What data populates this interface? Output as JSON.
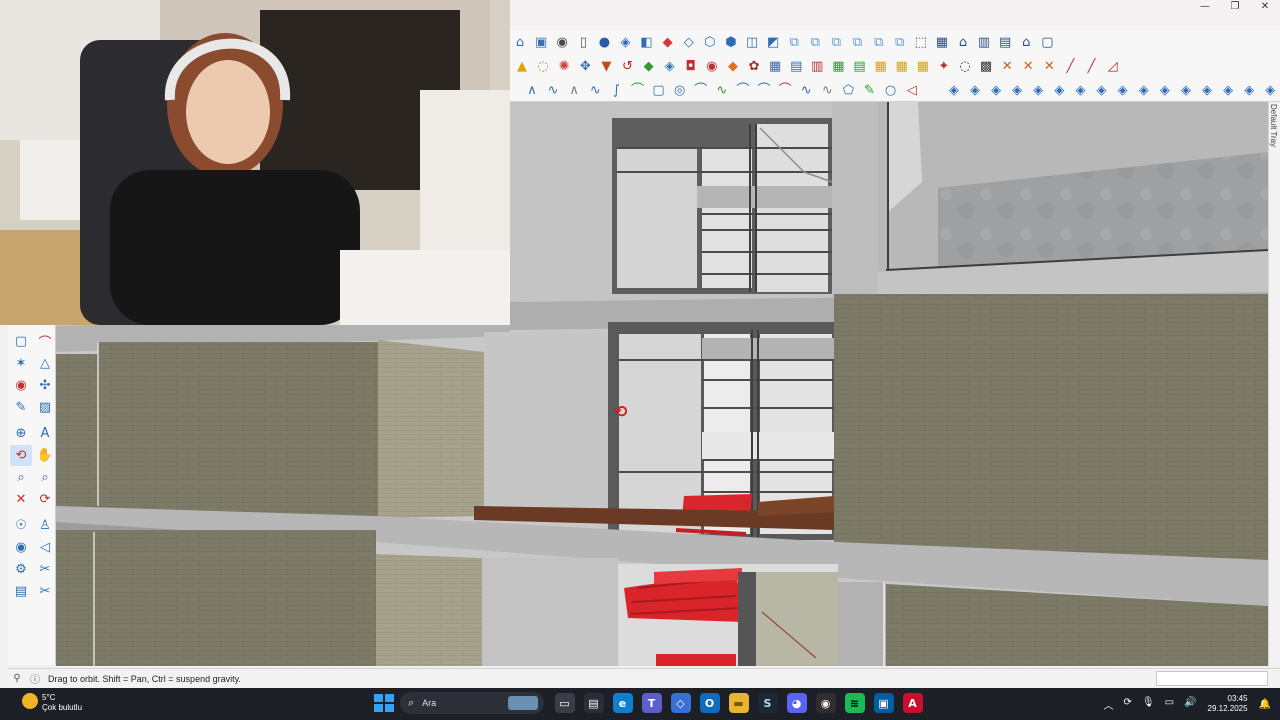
{
  "window": {
    "controls": [
      "—",
      "❐",
      "✕"
    ],
    "tray_label": "Default Tray"
  },
  "toolbars": {
    "row1": [
      {
        "icon": "warehouse-icon",
        "glyph": "⌂",
        "color": "#3b6fb6"
      },
      {
        "icon": "components-icon",
        "glyph": "▣",
        "color": "#3b6fb6"
      },
      {
        "icon": "user-settings-icon",
        "glyph": "◉",
        "color": "#4a4a4a"
      },
      {
        "icon": "new-file-icon",
        "glyph": "▯",
        "color": "#555"
      },
      {
        "icon": "account-icon",
        "glyph": "●",
        "color": "#2a5ca8"
      },
      {
        "icon": "sandbox-icon",
        "glyph": "◈",
        "color": "#2e6db4"
      },
      {
        "icon": "section-icon",
        "glyph": "◧",
        "color": "#2e6db4"
      },
      {
        "icon": "paint-icon",
        "glyph": "◆",
        "color": "#d23b3b"
      },
      {
        "icon": "style-icon",
        "glyph": "◇",
        "color": "#2e6db4"
      },
      {
        "icon": "iso-view-icon",
        "glyph": "⬡",
        "color": "#2e6db4"
      },
      {
        "icon": "top-view-icon",
        "glyph": "⬢",
        "color": "#2e6db4"
      },
      {
        "icon": "front-view-icon",
        "glyph": "◫",
        "color": "#2e6db4"
      },
      {
        "icon": "right-view-icon",
        "glyph": "◩",
        "color": "#2e6db4"
      },
      {
        "icon": "copy-icon",
        "glyph": "⧉",
        "color": "#5a9ad6"
      },
      {
        "icon": "move-icon",
        "glyph": "⧉",
        "color": "#5a9ad6"
      },
      {
        "icon": "rotate-icon",
        "glyph": "⧉",
        "color": "#5a9ad6"
      },
      {
        "icon": "scale-icon",
        "glyph": "⧉",
        "color": "#5a9ad6"
      },
      {
        "icon": "offset-icon",
        "glyph": "⧉",
        "color": "#5a9ad6"
      },
      {
        "icon": "array-icon",
        "glyph": "⧉",
        "color": "#5a9ad6"
      },
      {
        "icon": "box-icon",
        "glyph": "⬚",
        "color": "#2e4d80"
      },
      {
        "icon": "wall-icon",
        "glyph": "▦",
        "color": "#2e4d80"
      },
      {
        "icon": "house-icon",
        "glyph": "⌂",
        "color": "#2e4d80"
      },
      {
        "icon": "grid-icon",
        "glyph": "▥",
        "color": "#2e4d80"
      },
      {
        "icon": "panel-icon",
        "glyph": "▤",
        "color": "#2e4d80"
      },
      {
        "icon": "roof-icon",
        "glyph": "⌂",
        "color": "#2e4d80"
      },
      {
        "icon": "frame-icon",
        "glyph": "▢",
        "color": "#2e4d80"
      }
    ],
    "row2": [
      {
        "icon": "warning-icon",
        "glyph": "▲",
        "color": "#e0a400"
      },
      {
        "icon": "lasso-icon",
        "glyph": "◌",
        "color": "#e08000"
      },
      {
        "icon": "cycle-icon",
        "glyph": "✺",
        "color": "#d04040"
      },
      {
        "icon": "move-arrows-icon",
        "glyph": "✥",
        "color": "#2e6db4"
      },
      {
        "icon": "bucket-icon",
        "glyph": "▼",
        "color": "#c84a1a"
      },
      {
        "icon": "undo-icon",
        "glyph": "↺",
        "color": "#d02020"
      },
      {
        "icon": "gem-icon",
        "glyph": "◆",
        "color": "#2a9d2a"
      },
      {
        "icon": "cube-icon",
        "glyph": "◈",
        "color": "#3b6fb6"
      },
      {
        "icon": "solid-icon",
        "glyph": "◘",
        "color": "#c03030"
      },
      {
        "icon": "fill-icon",
        "glyph": "◉",
        "color": "#c03030"
      },
      {
        "icon": "diamond-icon",
        "glyph": "◆",
        "color": "#e07020"
      },
      {
        "icon": "cluster-icon",
        "glyph": "✿",
        "color": "#a03030"
      },
      {
        "icon": "table-icon",
        "glyph": "▦",
        "color": "#2e6db4"
      },
      {
        "icon": "layers-icon",
        "glyph": "▤",
        "color": "#2e6db4"
      },
      {
        "icon": "stack-icon",
        "glyph": "▥",
        "color": "#c03030"
      },
      {
        "icon": "grid-green-icon",
        "glyph": "▦",
        "color": "#2a9d2a"
      },
      {
        "icon": "stack-green-icon",
        "glyph": "▤",
        "color": "#2a9d2a"
      },
      {
        "icon": "cell-yellow-icon",
        "glyph": "▦",
        "color": "#e0a000"
      },
      {
        "icon": "cell-yellow-2-icon",
        "glyph": "▦",
        "color": "#e0a000"
      },
      {
        "icon": "cell-yellow-3-icon",
        "glyph": "▦",
        "color": "#e0a000"
      },
      {
        "icon": "scatter-icon",
        "glyph": "✦",
        "color": "#c03030"
      },
      {
        "icon": "rotate-dash-icon",
        "glyph": "◌",
        "color": "#333"
      },
      {
        "icon": "grid-dots-icon",
        "glyph": "▩",
        "color": "#333"
      },
      {
        "icon": "cross-1-icon",
        "glyph": "✕",
        "color": "#d06020"
      },
      {
        "icon": "cross-2-icon",
        "glyph": "✕",
        "color": "#d06020"
      },
      {
        "icon": "cross-3-icon",
        "glyph": "✕",
        "color": "#d06020"
      },
      {
        "icon": "line-extend-icon",
        "glyph": "╱",
        "color": "#c03030"
      },
      {
        "icon": "line-trim-icon",
        "glyph": "╱",
        "color": "#c03030"
      },
      {
        "icon": "bound-icon",
        "glyph": "◿",
        "color": "#c03030"
      }
    ],
    "row3": [
      {
        "icon": "curve-1-icon",
        "glyph": "∧",
        "color": "#2e6db4"
      },
      {
        "icon": "curve-2-icon",
        "glyph": "∿",
        "color": "#2e6db4"
      },
      {
        "icon": "curve-3-icon",
        "glyph": "∧",
        "color": "#7a7a7a"
      },
      {
        "icon": "curve-4-icon",
        "glyph": "∿",
        "color": "#2e6db4"
      },
      {
        "icon": "curve-5-icon",
        "glyph": "∫",
        "color": "#2e6db4"
      },
      {
        "icon": "arc-icon",
        "glyph": "⌒",
        "color": "#2a9d2a"
      },
      {
        "icon": "rect-icon",
        "glyph": "▢",
        "color": "#2e6db4"
      },
      {
        "icon": "spiral-icon",
        "glyph": "◎",
        "color": "#2e6db4"
      },
      {
        "icon": "bend-icon",
        "glyph": "⌒",
        "color": "#2e6db4"
      },
      {
        "icon": "wave-icon",
        "glyph": "∿",
        "color": "#2a9d2a"
      },
      {
        "icon": "arc-2-icon",
        "glyph": "⌒",
        "color": "#2e6db4"
      },
      {
        "icon": "arc-3-icon",
        "glyph": "⌒",
        "color": "#2e6db4"
      },
      {
        "icon": "arc-red-icon",
        "glyph": "⌒",
        "color": "#c03030"
      },
      {
        "icon": "curve-6-icon",
        "glyph": "∿",
        "color": "#2e6db4"
      },
      {
        "icon": "zigzag-icon",
        "glyph": "∿",
        "color": "#7a7a7a"
      },
      {
        "icon": "polygon-icon",
        "glyph": "⬠",
        "color": "#2e6db4"
      },
      {
        "icon": "pencil-icon",
        "glyph": "✎",
        "color": "#2a9d2a"
      },
      {
        "icon": "circle-icon",
        "glyph": "○",
        "color": "#2e6db4"
      },
      {
        "icon": "tag-icon",
        "glyph": "◁",
        "color": "#c03030"
      },
      {
        "icon": "pad-1-icon",
        "glyph": "",
        "color": "#fff"
      },
      {
        "icon": "shape-1-icon",
        "glyph": "◈",
        "color": "#2e6db4"
      },
      {
        "icon": "shape-2-icon",
        "glyph": "◈",
        "color": "#2e6db4"
      },
      {
        "icon": "shape-3-icon",
        "glyph": "◈",
        "color": "#2e6db4"
      },
      {
        "icon": "shape-4-icon",
        "glyph": "◈",
        "color": "#2e6db4"
      },
      {
        "icon": "shape-5-icon",
        "glyph": "◈",
        "color": "#2e6db4"
      },
      {
        "icon": "shape-6-icon",
        "glyph": "◈",
        "color": "#2e6db4"
      },
      {
        "icon": "shape-7-icon",
        "glyph": "◈",
        "color": "#2e6db4"
      },
      {
        "icon": "shape-8-icon",
        "glyph": "◈",
        "color": "#2e6db4"
      },
      {
        "icon": "shape-9-icon",
        "glyph": "◈",
        "color": "#2e6db4"
      },
      {
        "icon": "shape-10-icon",
        "glyph": "◈",
        "color": "#2e6db4"
      },
      {
        "icon": "shape-11-icon",
        "glyph": "◈",
        "color": "#2e6db4"
      },
      {
        "icon": "shape-12-icon",
        "glyph": "◈",
        "color": "#2e6db4"
      },
      {
        "icon": "shape-13-icon",
        "glyph": "◈",
        "color": "#2e6db4"
      },
      {
        "icon": "shape-14-icon",
        "glyph": "◈",
        "color": "#2e6db4"
      },
      {
        "icon": "shape-15-icon",
        "glyph": "◈",
        "color": "#2e6db4"
      },
      {
        "icon": "shape-16-icon",
        "glyph": "◈",
        "color": "#2e6db4"
      },
      {
        "icon": "shape-17-icon",
        "glyph": "◈",
        "color": "#2e6db4"
      },
      {
        "icon": "shape-18-icon",
        "glyph": "◈",
        "color": "#2e6db4"
      }
    ]
  },
  "left_palette": [
    {
      "icon": "rectangle-select-icon",
      "glyph": "▢",
      "color": "#2e6db4"
    },
    {
      "icon": "lasso-red-icon",
      "glyph": "⌒",
      "color": "#c03030"
    },
    {
      "icon": "scatter-tool-icon",
      "glyph": "✶",
      "color": "#2e6db4"
    },
    {
      "icon": "triangle-tool-icon",
      "glyph": "△",
      "color": "#2e6db4"
    },
    {
      "icon": "point-tool-icon",
      "glyph": "◉",
      "color": "#c03030"
    },
    {
      "icon": "nodes-tool-icon",
      "glyph": "✣",
      "color": "#2e6db4"
    },
    {
      "icon": "pen-tool-icon",
      "glyph": "✎",
      "color": "#2e6db4"
    },
    {
      "icon": "image-tool-icon",
      "glyph": "▨",
      "color": "#2e6db4"
    },
    {
      "icon": "target-tool-icon",
      "glyph": "⊕",
      "color": "#2e6db4"
    },
    {
      "icon": "text-tool-icon",
      "glyph": "A",
      "color": "#2e6db4"
    },
    {
      "icon": "orbit-tool-icon",
      "glyph": "⟲",
      "color": "#c03030",
      "active": true
    },
    {
      "icon": "pan-tool-icon",
      "glyph": "✋",
      "color": "#2e6db4"
    },
    {
      "icon": "zoom-tool-icon",
      "glyph": "⌕",
      "color": "#2e6db4"
    },
    {
      "icon": "zoom-window-icon",
      "glyph": "⌕",
      "color": "#2e6db4"
    },
    {
      "icon": "zoom-extents-icon",
      "glyph": "✕",
      "color": "#c03030"
    },
    {
      "icon": "previous-view-icon",
      "glyph": "⟳",
      "color": "#c03030"
    },
    {
      "icon": "position-camera-icon",
      "glyph": "☉",
      "color": "#2e6db4"
    },
    {
      "icon": "walk-icon",
      "glyph": "♙",
      "color": "#2e6db4"
    },
    {
      "icon": "look-around-icon",
      "glyph": "◉",
      "color": "#2e6db4"
    },
    {
      "icon": "section-plane-icon",
      "glyph": "◁",
      "color": "#2e6db4"
    },
    {
      "icon": "settings-wheel-icon",
      "glyph": "⚙",
      "color": "#2e6db4"
    },
    {
      "icon": "tools-icon",
      "glyph": "✂",
      "color": "#2e6db4"
    },
    {
      "icon": "stack-tool-icon",
      "glyph": "▤",
      "color": "#2e6db4"
    },
    {
      "icon": "paths-tool-icon",
      "glyph": "✂",
      "color": "#2e6db4"
    }
  ],
  "status": {
    "message": "Drag to orbit. Shift = Pan, Ctrl = suspend gravity."
  },
  "taskbar": {
    "weather_temp": "5°C",
    "weather_desc": "Çok bulutlu",
    "search_label": "Ara",
    "apps": [
      {
        "icon": "task-view-icon",
        "glyph": "▭",
        "bg": "#3a3d47",
        "fg": "#fff"
      },
      {
        "icon": "store-icon",
        "glyph": "▤",
        "bg": "#2b2e38",
        "fg": "#fff"
      },
      {
        "icon": "edge-icon",
        "glyph": "e",
        "bg": "#0f7fce",
        "fg": "#fff"
      },
      {
        "icon": "teams-icon",
        "glyph": "T",
        "bg": "#5b5fc7",
        "fg": "#fff"
      },
      {
        "icon": "copilot-icon",
        "glyph": "◇",
        "bg": "#3a6fd8",
        "fg": "#fff"
      },
      {
        "icon": "outlook-icon",
        "glyph": "O",
        "bg": "#0f6cbd",
        "fg": "#fff"
      },
      {
        "icon": "explorer-icon",
        "glyph": "▬",
        "bg": "#e8b532",
        "fg": "#7a5a00"
      },
      {
        "icon": "steam-icon",
        "glyph": "S",
        "bg": "#1b2838",
        "fg": "#c7d5e0"
      },
      {
        "icon": "discord-icon",
        "glyph": "◕",
        "bg": "#5865f2",
        "fg": "#fff"
      },
      {
        "icon": "obs-icon",
        "glyph": "◉",
        "bg": "#302e31",
        "fg": "#fff"
      },
      {
        "icon": "spotify-icon",
        "glyph": "≋",
        "bg": "#1db954",
        "fg": "#000"
      },
      {
        "icon": "sketchup-icon",
        "glyph": "▣",
        "bg": "#005f9e",
        "fg": "#fff"
      },
      {
        "icon": "archicad-icon",
        "glyph": "A",
        "bg": "#c8102e",
        "fg": "#fff"
      }
    ],
    "tray_icons": [
      {
        "icon": "chevron-up-icon",
        "glyph": "︿"
      },
      {
        "icon": "sync-icon",
        "glyph": "⟳"
      },
      {
        "icon": "mic-icon",
        "glyph": "🎙"
      },
      {
        "icon": "display-icon",
        "glyph": "▭"
      },
      {
        "icon": "volume-icon",
        "glyph": "🔊"
      }
    ],
    "time": "03:45",
    "date": "29.12.2025",
    "notification_glyph": "🔔"
  }
}
